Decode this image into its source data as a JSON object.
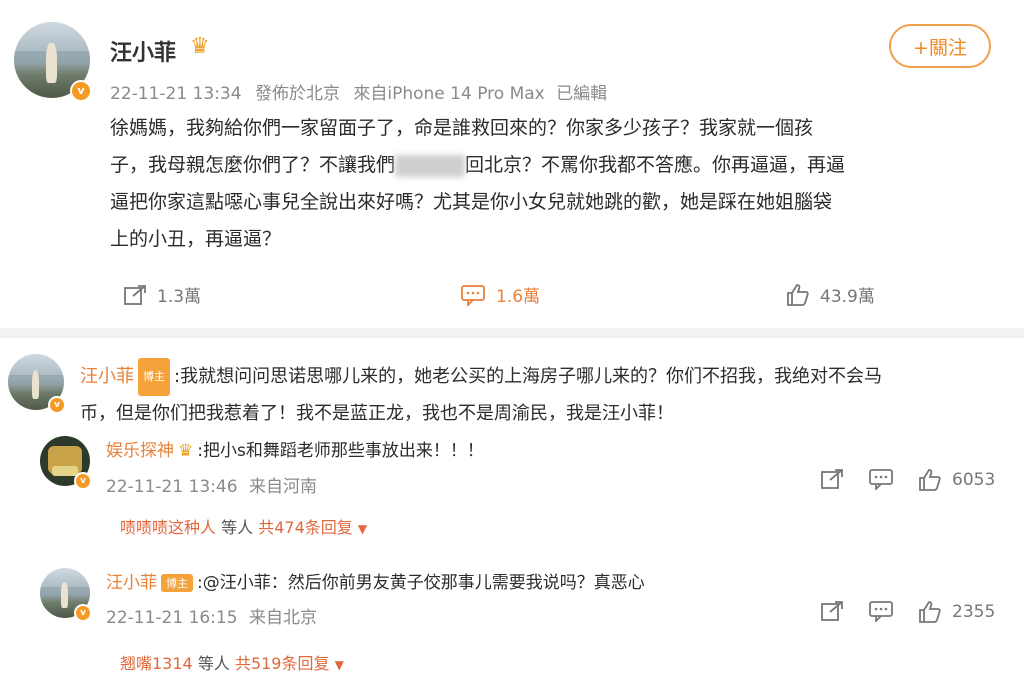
{
  "post": {
    "author": "汪小菲",
    "timestamp": "22-11-21 13:34",
    "published_from": "發佈於北京",
    "device": "來自iPhone 14 Pro Max",
    "edited": "已編輯",
    "follow_label": "+關注",
    "text_line1": "徐媽媽，我夠給你們一家留面子了，命是誰救回來的？你家多少孩子？我家就一個孩",
    "text_line2_a": "子，我母親怎麼你們了？不讓我們",
    "text_line2_b": "回北京？不罵你我都不答應。你再逼逼，再逼",
    "text_line3": "逼把你家這點噁心事兒全說出來好嗎？尤其是你小女兒就她跳的歡，她是踩在她姐腦袋",
    "text_line4": "上的小丑，再逼逼？",
    "shares": "1.3萬",
    "comments": "1.6萬",
    "likes": "43.9萬"
  },
  "comment1": {
    "author": "汪小菲",
    "tag": "博主",
    "text_line1": ":我就想问问思诺思哪儿来的，她老公买的上海房子哪儿来的？你们不招我，我绝对不会马",
    "text_line2": "币，但是你们把我惹着了！我不是蓝正龙，我也不是周渝民，我是汪小菲！"
  },
  "reply1": {
    "author": "娱乐探神",
    "text": ":把小s和舞蹈老师那些事放出来！！！",
    "timestamp": "22-11-21 13:46",
    "location": "来自河南",
    "likes": "6053",
    "replier": "啧啧啧这种人",
    "replier_suffix": "等人",
    "reply_count": "共474条回复"
  },
  "reply2": {
    "author": "汪小菲",
    "tag": "博主",
    "text": ":@汪小菲：然后你前男友黄子佼那事儿需要我说吗？真恶心",
    "timestamp": "22-11-21 16:15",
    "location": "来自北京",
    "likes": "2355",
    "replier": "翘嘴1314",
    "replier_suffix": "等人",
    "reply_count": "共519条回复"
  },
  "icons": [
    "share-icon",
    "comment-icon",
    "like-icon",
    "verified-badge-icon",
    "crown-icon",
    "chevron-down-icon"
  ],
  "colors": {
    "accent": "#f08a24",
    "link": "#e2683c",
    "meta": "#8a8a8a"
  }
}
